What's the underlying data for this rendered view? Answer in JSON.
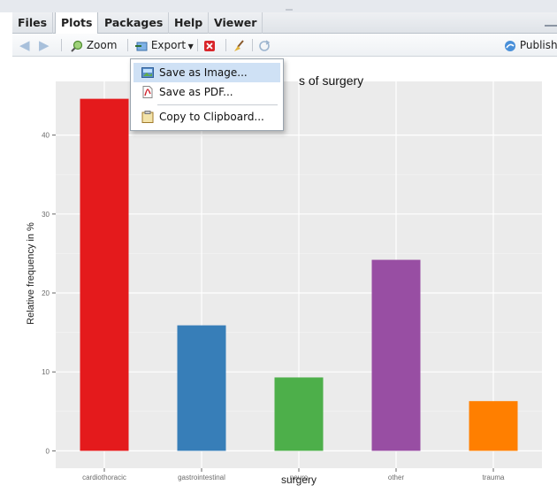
{
  "tabs": [
    {
      "label": "Files"
    },
    {
      "label": "Plots"
    },
    {
      "label": "Packages"
    },
    {
      "label": "Help"
    },
    {
      "label": "Viewer"
    }
  ],
  "active_tab": "Plots",
  "toolbar": {
    "zoom_label": "Zoom",
    "export_label": "Export",
    "publish_label": "Publish"
  },
  "export_menu": {
    "items": [
      {
        "label": "Save as Image...",
        "icon": "image-icon",
        "highlighted": true
      },
      {
        "label": "Save as PDF...",
        "icon": "pdf-icon",
        "highlighted": false
      },
      {
        "label": "Copy to Clipboard...",
        "icon": "clipboard-icon",
        "highlighted": false
      }
    ]
  },
  "chart_data": {
    "type": "bar",
    "title": "s of surgery",
    "xlabel": "surgery",
    "ylabel": "Relative frequency in %",
    "categories": [
      "cardiothoracic",
      "gastrointestinal",
      "neuro",
      "other",
      "trauma"
    ],
    "values": [
      44.6,
      15.9,
      9.3,
      24.2,
      6.3
    ],
    "colors": [
      "#e41a1c",
      "#377eb8",
      "#4daf4a",
      "#984ea3",
      "#ff7f00"
    ],
    "yticks": [
      0,
      10,
      20,
      30,
      40
    ],
    "ylim": [
      -2.2,
      46.8
    ],
    "grid": true,
    "panel_background": "#ebebeb"
  }
}
